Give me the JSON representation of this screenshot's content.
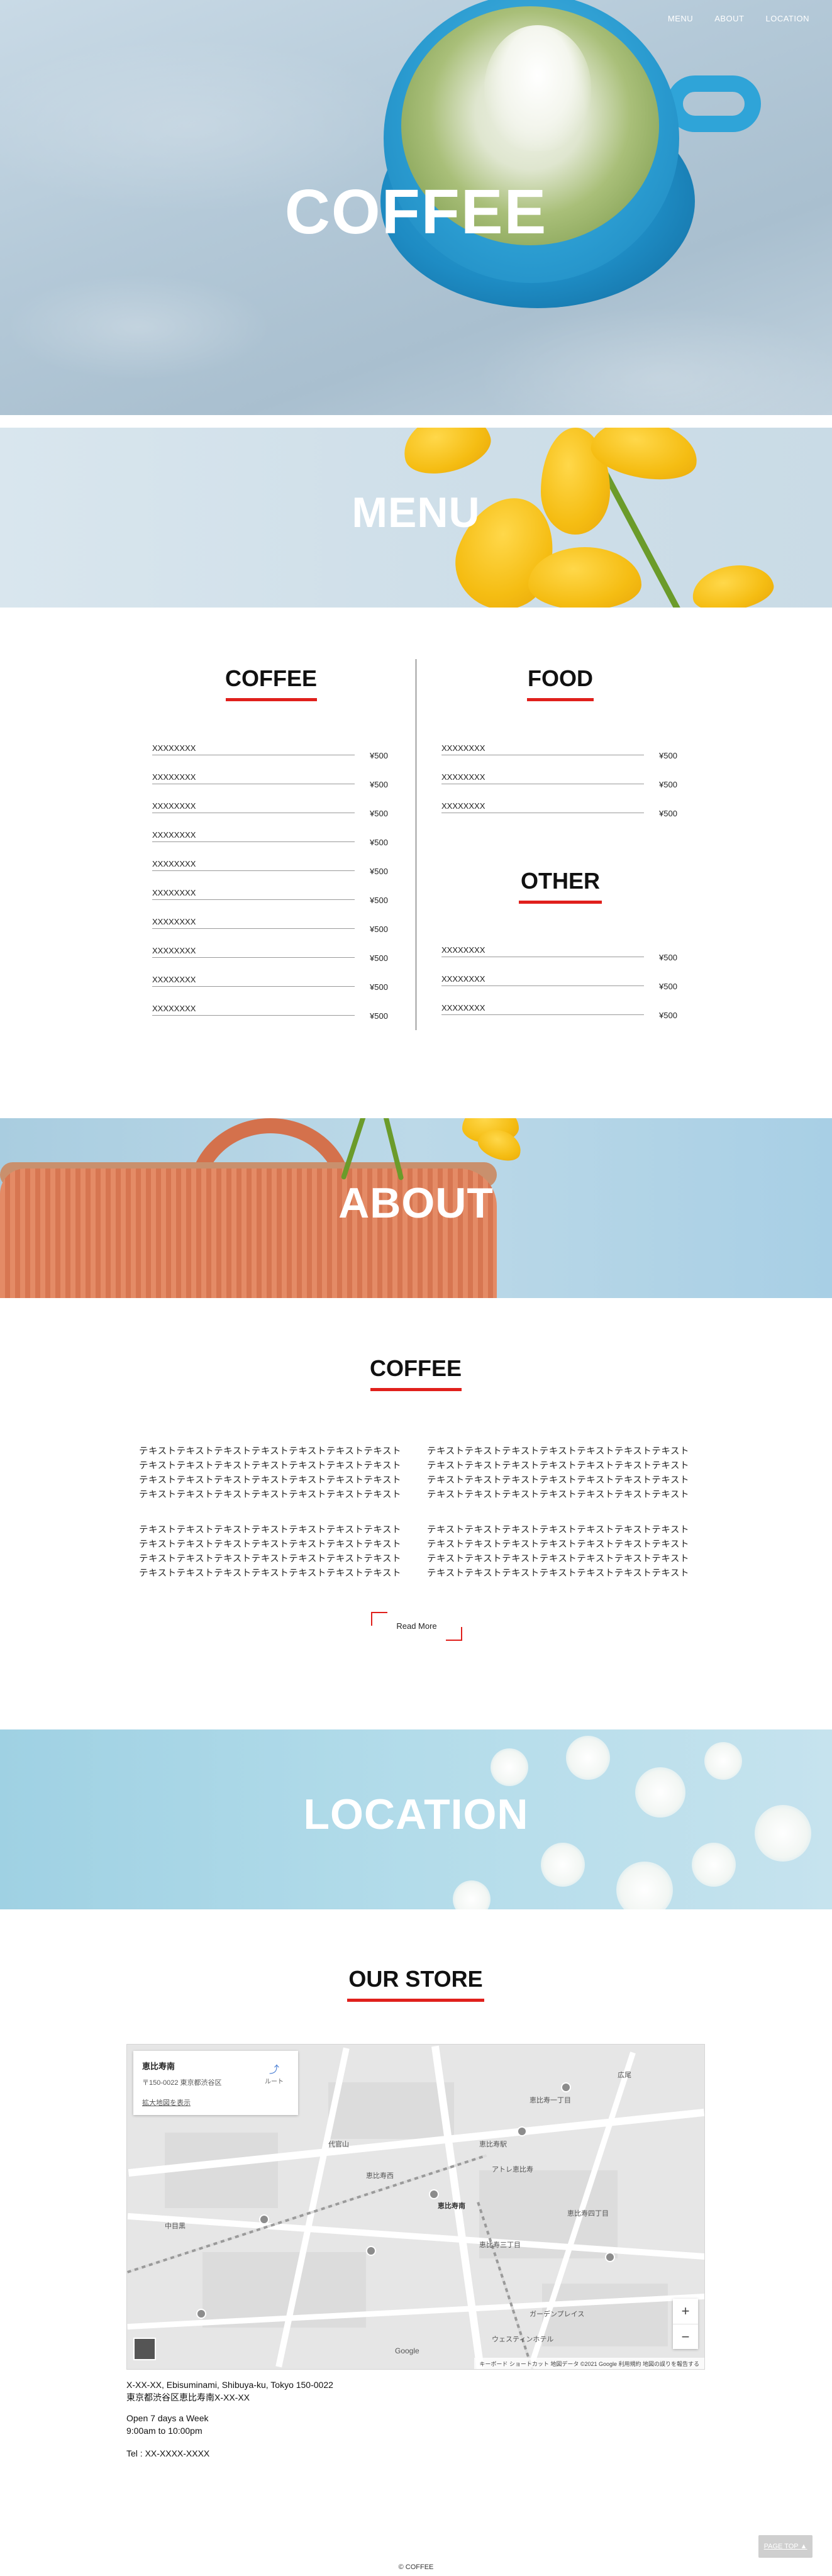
{
  "nav": {
    "items": [
      "MENU",
      "ABOUT",
      "LOCATION"
    ]
  },
  "hero": {
    "title": "COFFEE"
  },
  "banners": {
    "menu": "MENU",
    "about": "ABOUT",
    "location": "LOCATION"
  },
  "menu": {
    "coffee": {
      "heading": "COFFEE",
      "items": [
        {
          "name": "XXXXXXXX",
          "price": "¥500"
        },
        {
          "name": "XXXXXXXX",
          "price": "¥500"
        },
        {
          "name": "XXXXXXXX",
          "price": "¥500"
        },
        {
          "name": "XXXXXXXX",
          "price": "¥500"
        },
        {
          "name": "XXXXXXXX",
          "price": "¥500"
        },
        {
          "name": "XXXXXXXX",
          "price": "¥500"
        },
        {
          "name": "XXXXXXXX",
          "price": "¥500"
        },
        {
          "name": "XXXXXXXX",
          "price": "¥500"
        },
        {
          "name": "XXXXXXXX",
          "price": "¥500"
        },
        {
          "name": "XXXXXXXX",
          "price": "¥500"
        }
      ]
    },
    "food": {
      "heading": "FOOD",
      "items": [
        {
          "name": "XXXXXXXX",
          "price": "¥500"
        },
        {
          "name": "XXXXXXXX",
          "price": "¥500"
        },
        {
          "name": "XXXXXXXX",
          "price": "¥500"
        }
      ]
    },
    "other": {
      "heading": "OTHER",
      "items": [
        {
          "name": "XXXXXXXX",
          "price": "¥500"
        },
        {
          "name": "XXXXXXXX",
          "price": "¥500"
        },
        {
          "name": "XXXXXXXX",
          "price": "¥500"
        }
      ]
    }
  },
  "about": {
    "heading": "COFFEE",
    "paragraphs": [
      [
        "テキストテキストテキストテキストテキストテキストテキスト",
        "テキストテキストテキストテキストテキストテキストテキスト",
        "テキストテキストテキストテキストテキストテキストテキスト",
        "テキストテキストテキストテキストテキストテキストテキスト"
      ],
      [
        "テキストテキストテキストテキストテキストテキストテキスト",
        "テキストテキストテキストテキストテキストテキストテキスト",
        "テキストテキストテキストテキストテキストテキストテキスト",
        "テキストテキストテキストテキストテキストテキストテキスト"
      ],
      [
        "テキストテキストテキストテキストテキストテキストテキスト",
        "テキストテキストテキストテキストテキストテキストテキスト",
        "テキストテキストテキストテキストテキストテキストテキスト",
        "テキストテキストテキストテキストテキストテキストテキスト"
      ],
      [
        "テキストテキストテキストテキストテキストテキストテキスト",
        "テキストテキストテキストテキストテキストテキストテキスト",
        "テキストテキストテキストテキストテキストテキストテキスト",
        "テキストテキストテキストテキストテキストテキストテキスト"
      ]
    ],
    "read_more": "Read More"
  },
  "store": {
    "heading": "OUR STORE",
    "map": {
      "place_name": "恵比寿南",
      "place_address": "〒150-0022 東京都渋谷区",
      "larger_map": "拡大地図を表示",
      "route": "ルート",
      "zoom_in": "+",
      "zoom_out": "−",
      "google": "Google",
      "footer": "キーボード ショートカット   地図データ ©2021 Google   利用規約   地図の誤りを報告する",
      "labels": [
        "恵比寿南",
        "恵比寿駅",
        "ガーデンプレイス",
        "代官山",
        "恵比寿西",
        "恵比寿一丁目",
        "広尾",
        "中目黒",
        "恵比寿三丁目",
        "恵比寿四丁目",
        "アトレ恵比寿",
        "ウェスティンホテル"
      ]
    },
    "address_en": "X-XX-XX, Ebisuminami, Shibuya-ku, Tokyo 150-0022",
    "address_ja": "東京都渋谷区恵比寿南X-XX-XX",
    "hours_1": "Open 7 days a Week",
    "hours_2": "9:00am to 10:00pm",
    "tel": "Tel : XX-XXXX-XXXX"
  },
  "footer": {
    "page_top": "PAGE TOP ▲",
    "copyright": "© COFFEE"
  },
  "colors": {
    "accent": "#e0201c",
    "hero_blue": "#2a9bd0"
  }
}
